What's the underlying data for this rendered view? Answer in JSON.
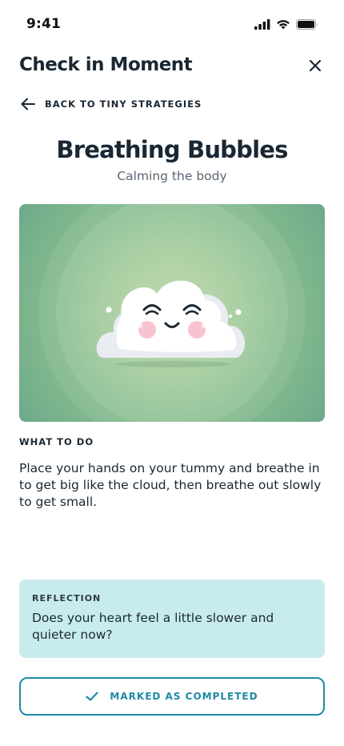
{
  "status_bar": {
    "time": "9:41"
  },
  "header": {
    "title": "Check in Moment"
  },
  "back_link": {
    "label": "BACK TO TINY STRATEGIES"
  },
  "activity": {
    "title": "Breathing Bubbles",
    "subtitle": "Calming the body"
  },
  "what_to_do": {
    "label": "WHAT TO DO",
    "text": "Place your hands on your tummy and breathe in to get big like the cloud, then breathe out slowly to get small."
  },
  "reflection": {
    "label": "REFLECTION",
    "text": "Does your heart feel a little slower and quieter now?"
  },
  "completed_button": {
    "label": "MARKED AS COMPLETED"
  },
  "colors": {
    "accent": "#1f8aa6",
    "reflection_bg": "#c8ecee",
    "hero_green": "#86bc8e"
  }
}
